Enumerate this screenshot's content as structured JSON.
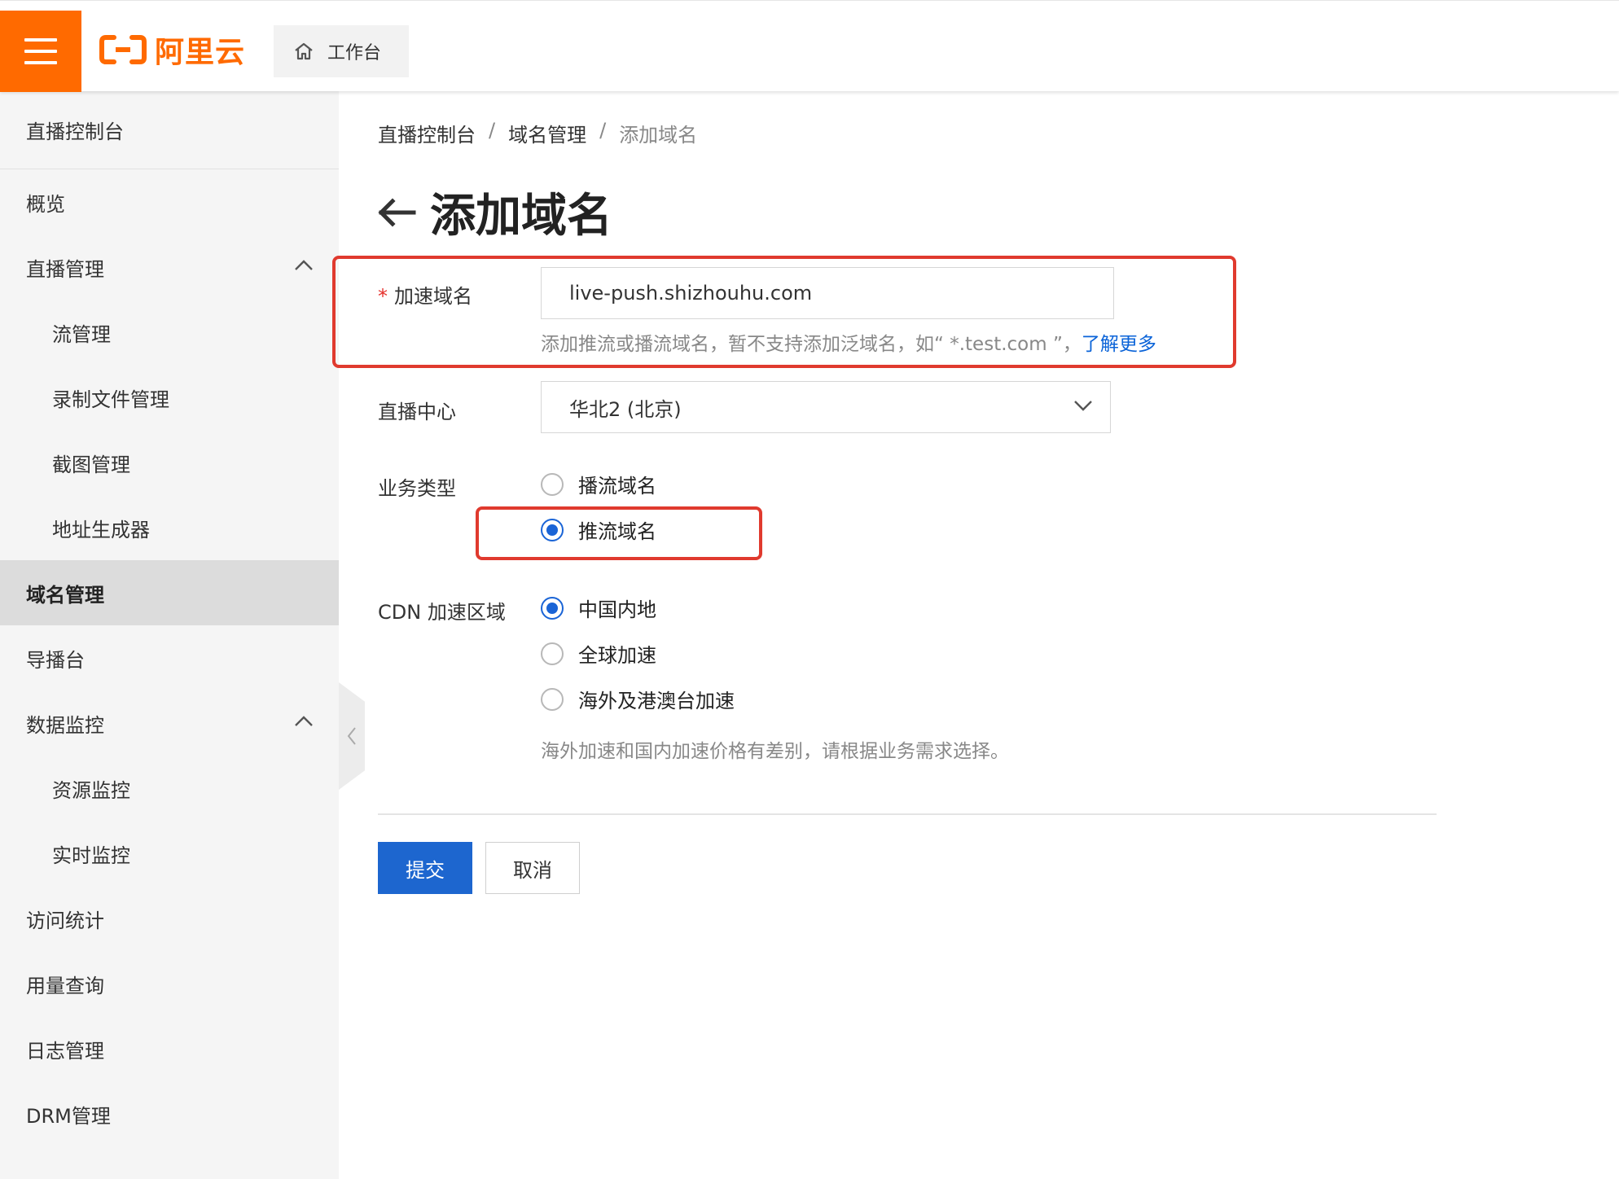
{
  "topbar": {
    "logo_text": "阿里云",
    "workbench_label": "工作台",
    "brand_color": "#ff6a00",
    "icons": [
      "menu-icon",
      "aliyun-logo-icon",
      "home-icon"
    ]
  },
  "sidebar": {
    "title": "直播控制台",
    "items": [
      {
        "label": "概览"
      },
      {
        "label": "直播管理",
        "expanded": true
      },
      {
        "label": "流管理"
      },
      {
        "label": "录制文件管理"
      },
      {
        "label": "截图管理"
      },
      {
        "label": "地址生成器"
      },
      {
        "label": "域名管理",
        "active": true
      },
      {
        "label": "导播台"
      },
      {
        "label": "数据监控",
        "expanded": true
      },
      {
        "label": "资源监控"
      },
      {
        "label": "实时监控"
      },
      {
        "label": "访问统计"
      },
      {
        "label": "用量查询"
      },
      {
        "label": "日志管理"
      },
      {
        "label": "DRM管理"
      }
    ]
  },
  "breadcrumb": {
    "items": [
      "直播控制台",
      "域名管理",
      "添加域名"
    ],
    "separator": "/"
  },
  "page": {
    "title": "添加域名"
  },
  "form": {
    "domain": {
      "required_mark": "*",
      "label": "加速域名",
      "value": "live-push.shizhouhu.com",
      "help": "添加推流或播流域名，暂不支持添加泛域名，如“ *.test.com ”，",
      "help_link": "了解更多"
    },
    "center": {
      "label": "直播中心",
      "selected": "华北2 (北京)"
    },
    "business_type": {
      "label": "业务类型",
      "options": [
        {
          "label": "播流域名",
          "checked": false
        },
        {
          "label": "推流域名",
          "checked": true
        }
      ]
    },
    "cdn_region": {
      "label": "CDN 加速区域",
      "options": [
        {
          "label": "中国内地",
          "checked": true
        },
        {
          "label": "全球加速",
          "checked": false
        },
        {
          "label": "海外及港澳台加速",
          "checked": false
        }
      ],
      "help": "海外加速和国内加速价格有差别，请根据业务需求选择。"
    },
    "submit_label": "提交",
    "cancel_label": "取消"
  },
  "colors": {
    "primary": "#1d66cf",
    "highlight_border": "#e03a2e",
    "link": "#0a63d8"
  }
}
